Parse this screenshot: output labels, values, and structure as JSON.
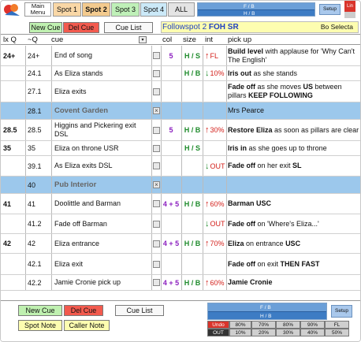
{
  "topbar": {
    "main_menu": "Main Menu",
    "spots": [
      "Spot 1",
      "Spot 2",
      "Spot 3",
      "Spot 4"
    ],
    "all": "ALL",
    "fb_top": "F / B",
    "fb_bottom": "H / B",
    "setup": "Setup",
    "corner": "Lin"
  },
  "controls": {
    "new_cue": "New Cue",
    "del_cue": "Del Cue",
    "cue_list": "Cue List"
  },
  "followspot": {
    "title": "Followspot 2",
    "position": "FOH SR",
    "show": "Bo Selecta"
  },
  "columns": {
    "lx": "lx Q",
    "q": "~Q",
    "cue": "cue",
    "col": "col",
    "size": "size",
    "int": "int",
    "pick": "pick up"
  },
  "rows": [
    {
      "lx": "24+",
      "q": "24+",
      "cue": "End of song",
      "col": "5",
      "size": "H / S",
      "dir": "up",
      "int": "FL",
      "pick": "<b>Build level</b> with applause for 'Why Can't The English'",
      "scene": false
    },
    {
      "lx": "",
      "q": "24.1",
      "cue": "As Eliza stands",
      "col": "",
      "size": "H / B",
      "dir": "down",
      "int": "10%",
      "pick": "<b>Iris out</b> as she stands",
      "scene": false
    },
    {
      "lx": "",
      "q": "27.1",
      "cue": "Eliza exits",
      "col": "",
      "size": "",
      "dir": "",
      "int": "",
      "pick": "<b>Fade off</b> as she moves <b>US</b> between pillars <b>KEEP FOLLOWING</b>",
      "scene": false
    },
    {
      "lx": "",
      "q": "28.1",
      "cue": "Covent Garden",
      "col": "",
      "size": "",
      "dir": "",
      "int": "",
      "pick": "Mrs Pearce",
      "scene": true
    },
    {
      "lx": "28.5",
      "q": "28.5",
      "cue": "Higgins and Pickering exit DSL",
      "col": "5",
      "size": "H / B",
      "dir": "up",
      "int": "30%",
      "pick": "<b>Restore Eliza</b> as soon as pillars are clear",
      "scene": false
    },
    {
      "lx": "35",
      "q": "35",
      "cue": "Eliza on throne USR",
      "col": "",
      "size": "H / S",
      "dir": "",
      "int": "",
      "pick": "<b>Iris in</b> as she goes up to throne",
      "scene": false
    },
    {
      "lx": "",
      "q": "39.1",
      "cue": "As Eliza exits DSL",
      "col": "",
      "size": "",
      "dir": "down",
      "int": "OUT",
      "pick": "<b>Fade off</b> on her exit <b>SL</b>",
      "scene": false
    },
    {
      "lx": "",
      "q": "40",
      "cue": "Pub Interior",
      "col": "",
      "size": "",
      "dir": "",
      "int": "",
      "pick": "",
      "scene": true
    },
    {
      "lx": "41",
      "q": "41",
      "cue": "Doolittle and Barman",
      "col": "4 + 5",
      "size": "H / B",
      "dir": "up",
      "int": "60%",
      "pick": "<b>Barman USC</b>",
      "scene": false
    },
    {
      "lx": "",
      "q": "41.2",
      "cue": "Fade off Barman",
      "col": "",
      "size": "",
      "dir": "down",
      "int": "OUT",
      "pick": "<b>Fade off</b> on 'Where's Eliza...'",
      "scene": false
    },
    {
      "lx": "42",
      "q": "42",
      "cue": "Eliza entrance",
      "col": "4 + 5",
      "size": "H / B",
      "dir": "up",
      "int": "70%",
      "pick": "<b>Eliza</b> on entrance <b>USC</b>",
      "scene": false
    },
    {
      "lx": "",
      "q": "42.1",
      "cue": "Eliza exit",
      "col": "",
      "size": "",
      "dir": "",
      "int": "",
      "pick": "<b>Fade off</b> on exit <b>THEN FAST</b>",
      "scene": false
    },
    {
      "lx": "",
      "q": "42.2",
      "cue": "Jamie Cronie pick up",
      "col": "4 + 5",
      "size": "H / B",
      "dir": "up",
      "int": "60%",
      "pick": "<b>Jamie Cronie</b>",
      "scene": false
    }
  ],
  "bottom": {
    "new_cue": "New Cue",
    "del_cue": "Del Cue",
    "cue_list": "Cue List",
    "spot_note": "Spot Note",
    "caller_note": "Caller Note",
    "fb_top": "F / B",
    "fb_bottom": "H / B",
    "setup": "Setup",
    "levels_top": [
      "Undo",
      "80%",
      "70%",
      "80%",
      "90%",
      "FL"
    ],
    "levels_bottom": [
      "OUT",
      "10%",
      "20%",
      "30%",
      "40%",
      "50%"
    ]
  },
  "colors": {
    "accent_blue": "#3d7cc4",
    "scene_row": "#9cc8ec",
    "del_red": "#f25a4e",
    "new_green": "#bff0b0"
  }
}
